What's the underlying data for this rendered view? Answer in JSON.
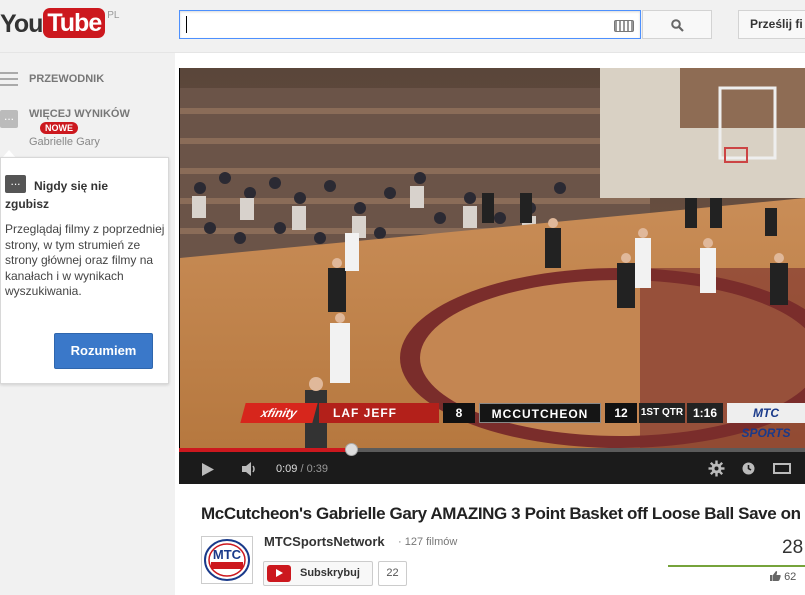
{
  "header": {
    "logo_you": "You",
    "logo_tube": "Tube",
    "logo_region": "PL",
    "search": {
      "value": "",
      "placeholder": ""
    },
    "upload_label": "Prześlij fi"
  },
  "guide": {
    "guide_label": "PRZEWODNIK",
    "more_label": "WIĘCEJ WYNIKÓW",
    "new_badge": "NOWE",
    "more_sub": "Gabrielle Gary"
  },
  "popup": {
    "title": "Nigdy się nie zgubisz",
    "text": "Przeglądaj filmy z poprzedniej strony, w tym strumień ze strony głównej oraz filmy na kanałach i w wynikach wyszukiwania.",
    "button": "Rozumiem"
  },
  "player": {
    "current_time": "0:09",
    "separator": " / ",
    "duration": "0:39",
    "progress": 0.275,
    "scoreboard": {
      "sponsor": "xfinity",
      "team_home": "LAF JEFF",
      "score_home": "8",
      "team_away": "MCCUTCHEON",
      "score_away": "12",
      "period": "1ST QTR",
      "clock": "1:16",
      "network": "MTC SPORTS"
    }
  },
  "video_info": {
    "title": "McCutcheon's Gabrielle Gary AMAZING 3 Point Basket off Loose Ball Save on",
    "channel_name": "MTCSportsNetwork",
    "channel_videos": "· 127 filmów",
    "subscribe_label": "Subskrybuj",
    "subscriber_count": "22",
    "views": "28",
    "likes": "62",
    "channel_logo_text": "MTC"
  },
  "colors": {
    "brand_red": "#cc181e",
    "button_blue": "#3a78c9",
    "like_green": "#76a33b"
  }
}
